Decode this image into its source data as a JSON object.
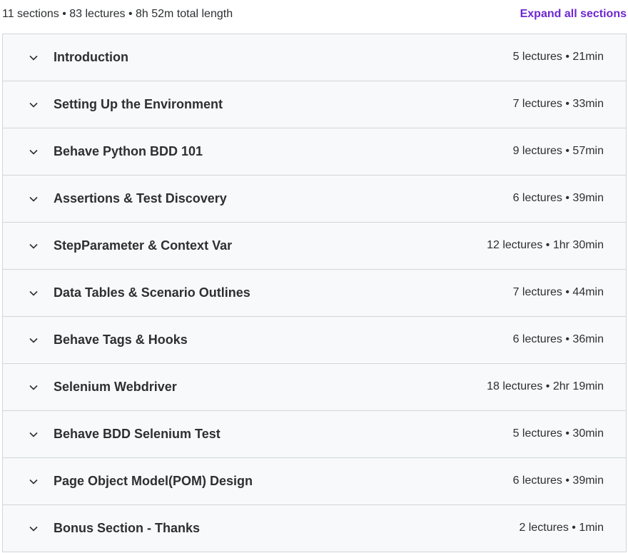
{
  "header": {
    "summary": "11 sections • 83 lectures • 8h 52m total length",
    "expand_label": "Expand all sections"
  },
  "colors": {
    "accent": "#6d28d2",
    "section_bg": "#f7f9fa",
    "border": "#d1d7dc",
    "text": "#2d2f31"
  },
  "sections": [
    {
      "title": "Introduction",
      "meta": "5 lectures • 21min",
      "icon": "chevron-down-icon"
    },
    {
      "title": "Setting Up the Environment",
      "meta": "7 lectures • 33min",
      "icon": "chevron-down-icon"
    },
    {
      "title": "Behave Python BDD 101",
      "meta": "9 lectures • 57min",
      "icon": "chevron-down-icon"
    },
    {
      "title": "Assertions & Test Discovery",
      "meta": "6 lectures • 39min",
      "icon": "chevron-down-icon"
    },
    {
      "title": "StepParameter & Context Var",
      "meta": "12 lectures • 1hr 30min",
      "icon": "chevron-down-icon"
    },
    {
      "title": "Data Tables & Scenario Outlines",
      "meta": "7 lectures • 44min",
      "icon": "chevron-down-icon"
    },
    {
      "title": "Behave Tags & Hooks",
      "meta": "6 lectures • 36min",
      "icon": "chevron-down-icon"
    },
    {
      "title": "Selenium Webdriver",
      "meta": "18 lectures • 2hr 19min",
      "icon": "chevron-down-icon"
    },
    {
      "title": "Behave BDD Selenium Test",
      "meta": "5 lectures • 30min",
      "icon": "chevron-down-icon"
    },
    {
      "title": "Page Object Model(POM) Design",
      "meta": "6 lectures • 39min",
      "icon": "chevron-down-icon"
    },
    {
      "title": "Bonus Section - Thanks",
      "meta": "2 lectures • 1min",
      "icon": "chevron-down-icon"
    }
  ]
}
